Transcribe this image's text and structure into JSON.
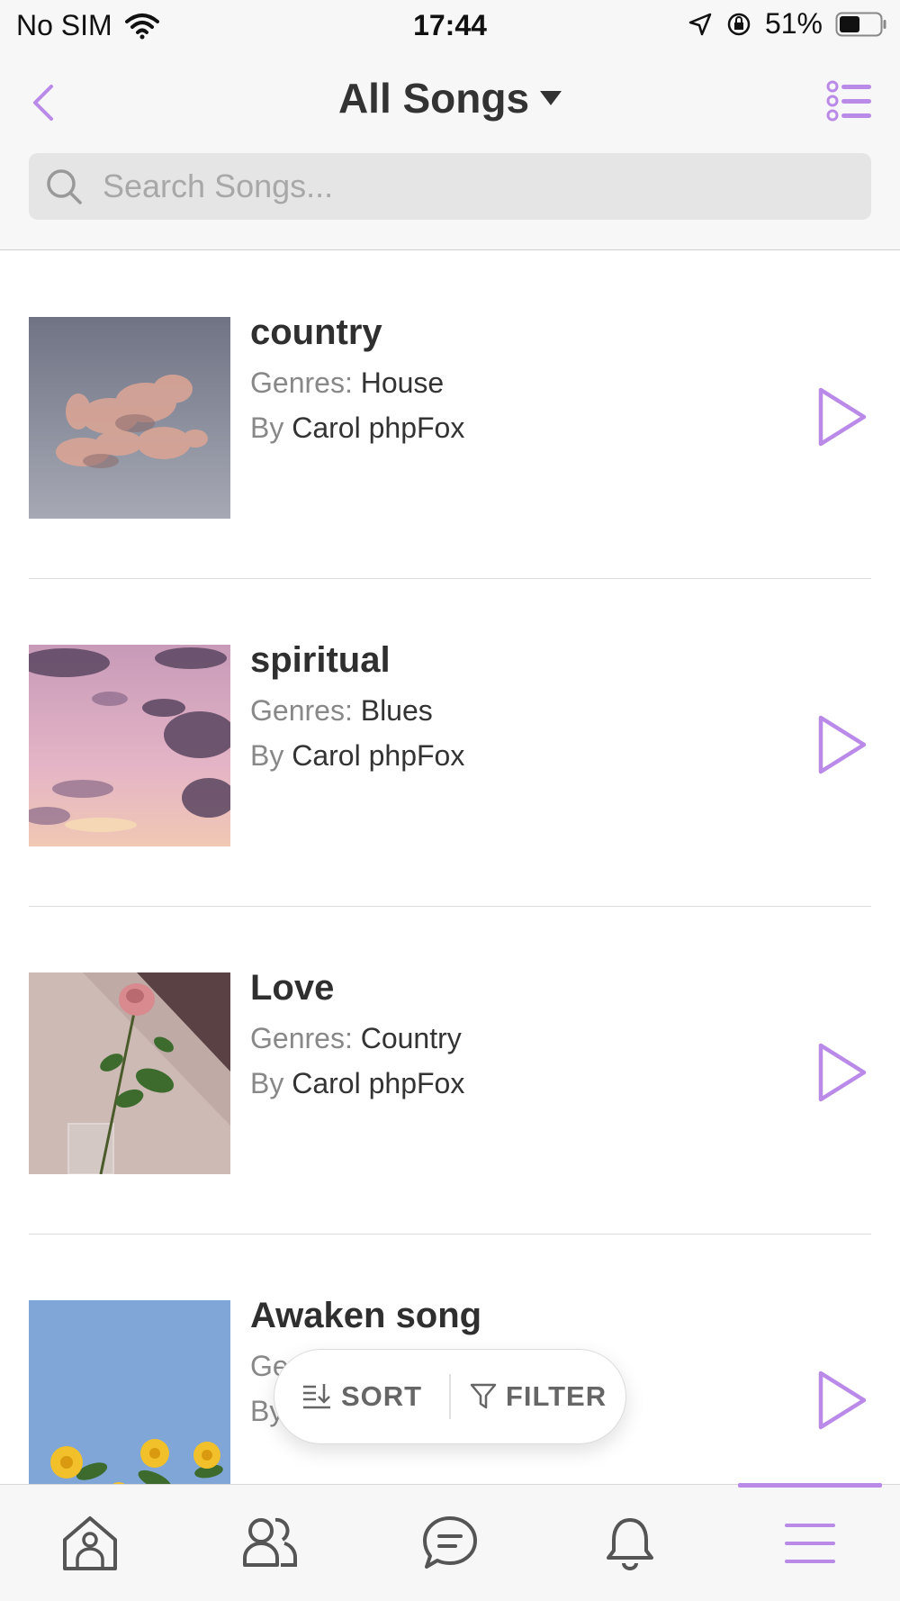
{
  "status_bar": {
    "carrier": "No SIM",
    "time": "17:44",
    "battery": "51%"
  },
  "header": {
    "title": "All Songs",
    "search_placeholder": "Search Songs..."
  },
  "songs": [
    {
      "title": "country",
      "genre_label": "Genres:",
      "genre": "House",
      "by_label": "By",
      "artist": "Carol phpFox"
    },
    {
      "title": "spiritual",
      "genre_label": "Genres:",
      "genre": "Blues",
      "by_label": "By",
      "artist": "Carol phpFox"
    },
    {
      "title": "Love",
      "genre_label": "Genres:",
      "genre": "Country",
      "by_label": "By",
      "artist": "Carol phpFox"
    },
    {
      "title": "Awaken song",
      "genre_label": "Ge",
      "genre": "",
      "by_label": "By",
      "artist": ""
    }
  ],
  "floating_bar": {
    "sort_label": "SORT",
    "filter_label": "FILTER"
  },
  "bottom_nav": {
    "items": [
      "home-icon",
      "friends-icon",
      "chat-icon",
      "bell-icon",
      "menu-icon"
    ],
    "active": "menu-icon"
  },
  "colors": {
    "accent": "#b98ae8",
    "bar_bg": "#f7f7f7",
    "search_bg": "#e5e5e5"
  }
}
